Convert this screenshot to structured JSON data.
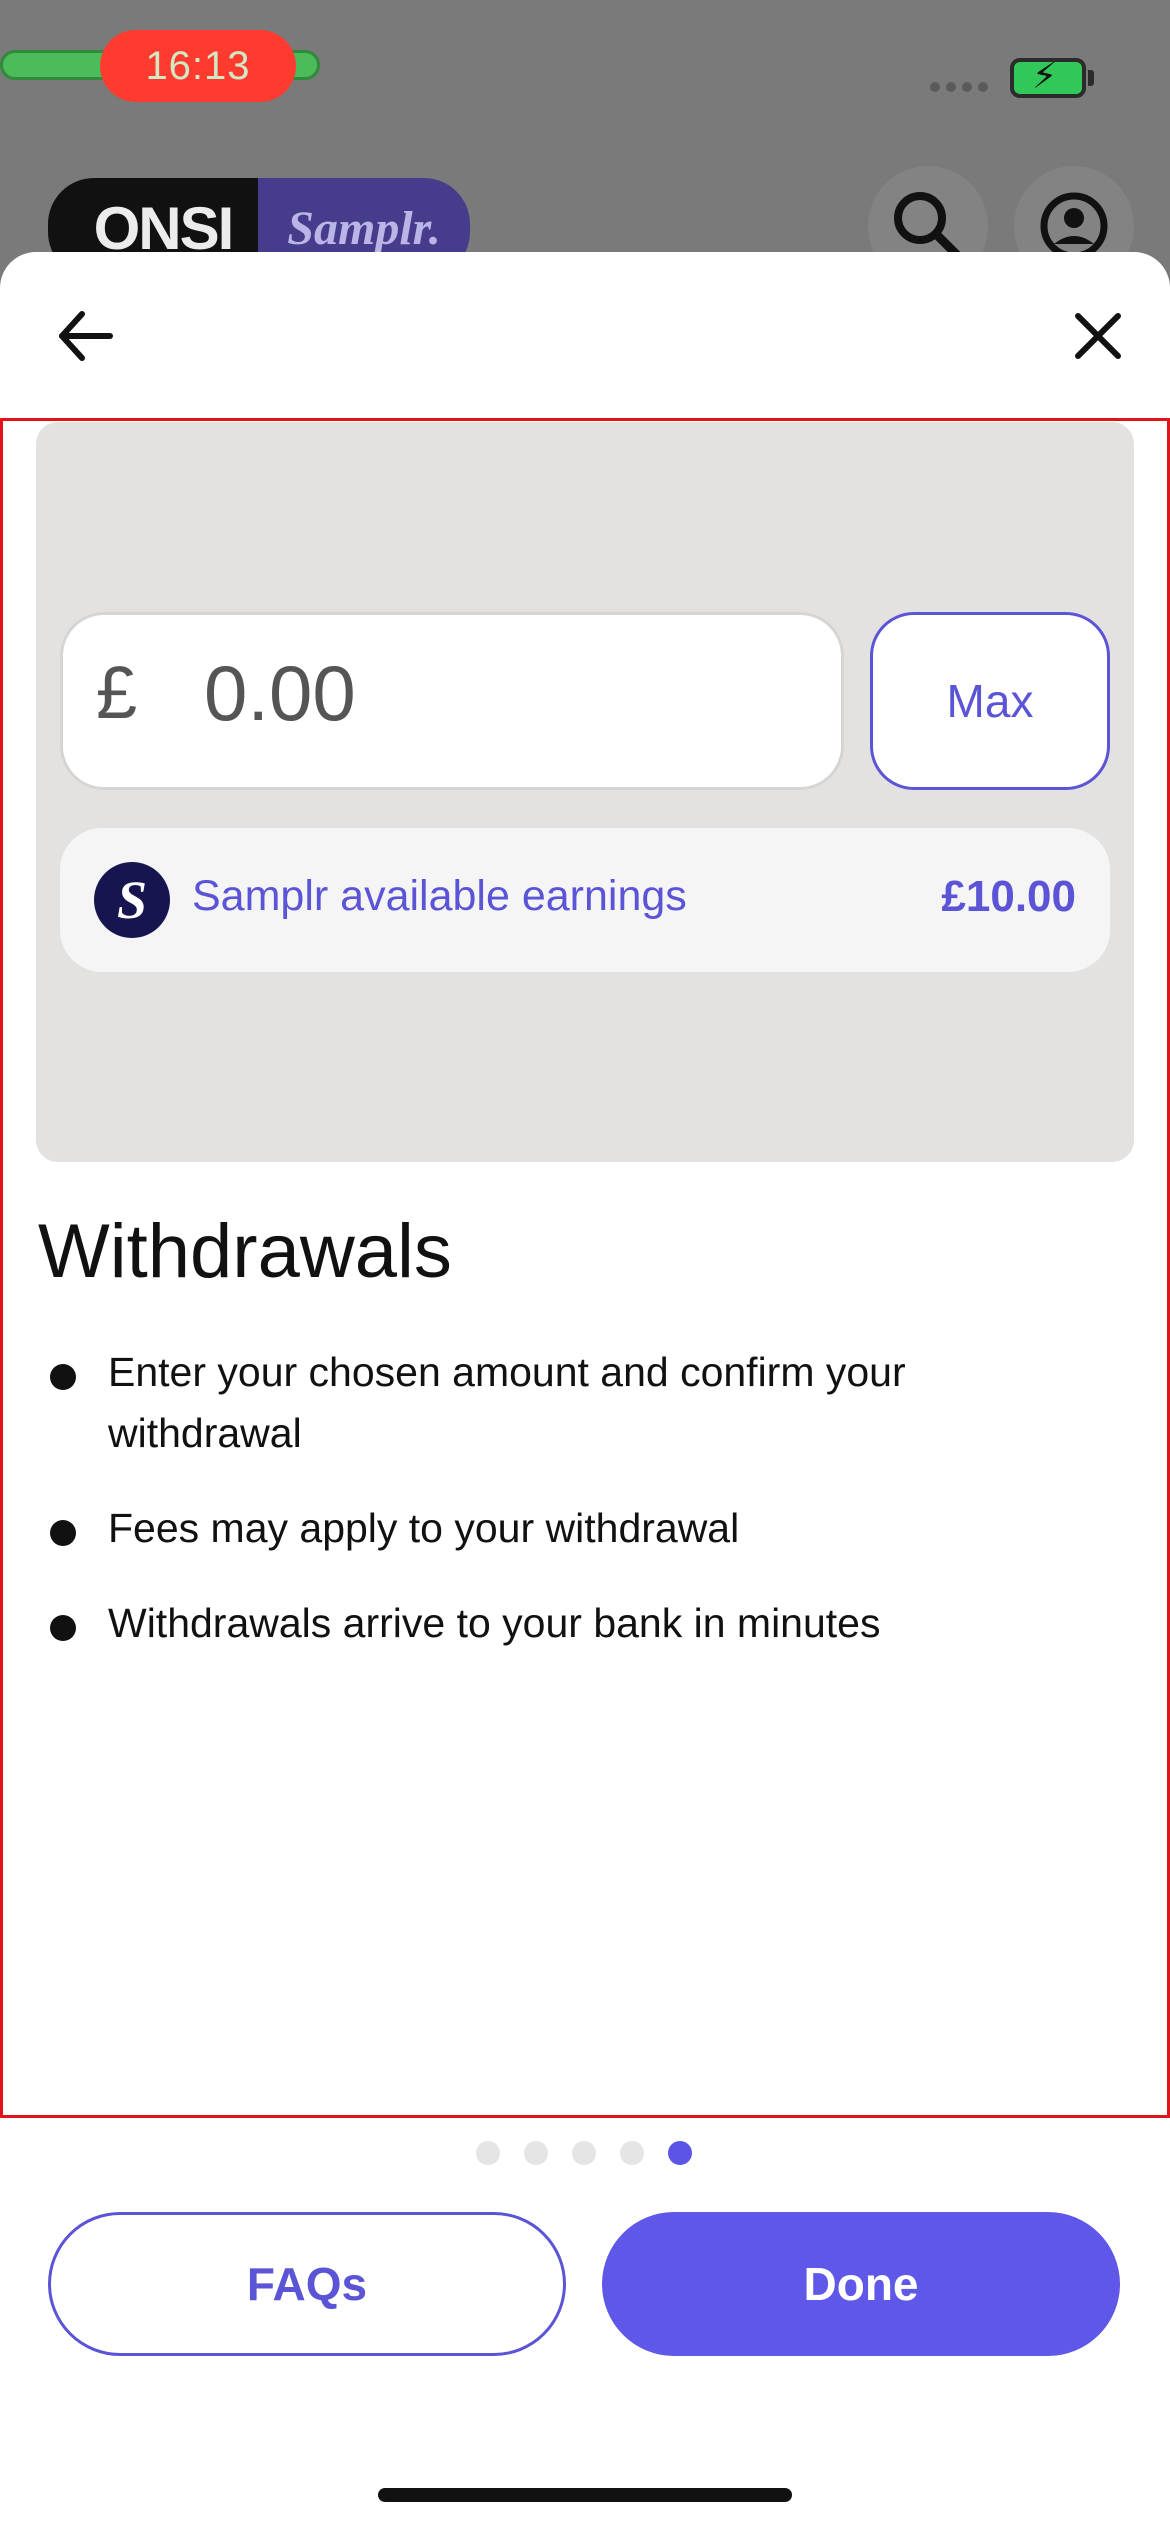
{
  "status_bar": {
    "time": "16:13",
    "battery_icon": "battery-charging-icon",
    "colors": {
      "time_pill": "#ff3b30",
      "battery": "#32c759"
    }
  },
  "background_app": {
    "logo_left": "ONSI",
    "logo_right": "Samplr.",
    "icons": [
      "search-icon",
      "profile-icon"
    ]
  },
  "nav": {
    "back_icon": "arrow-left-icon",
    "close_icon": "close-icon"
  },
  "illustration": {
    "currency": "£",
    "amount": "0.00",
    "max_label": "Max",
    "earnings_logo": "S",
    "earnings_label": "Samplr available earnings",
    "earnings_value": "£10.00"
  },
  "content": {
    "title": "Withdrawals",
    "bullets": [
      "Enter your chosen amount and confirm your withdrawal",
      "Fees may apply to your withdrawal",
      "Withdrawals arrive to your bank in minutes"
    ]
  },
  "pager": {
    "total": 5,
    "active": 5
  },
  "footer": {
    "faqs_label": "FAQs",
    "done_label": "Done"
  },
  "colors": {
    "accent": "#5b54d6",
    "primary_button": "#5f57e8",
    "card": "#e3e2e1"
  }
}
